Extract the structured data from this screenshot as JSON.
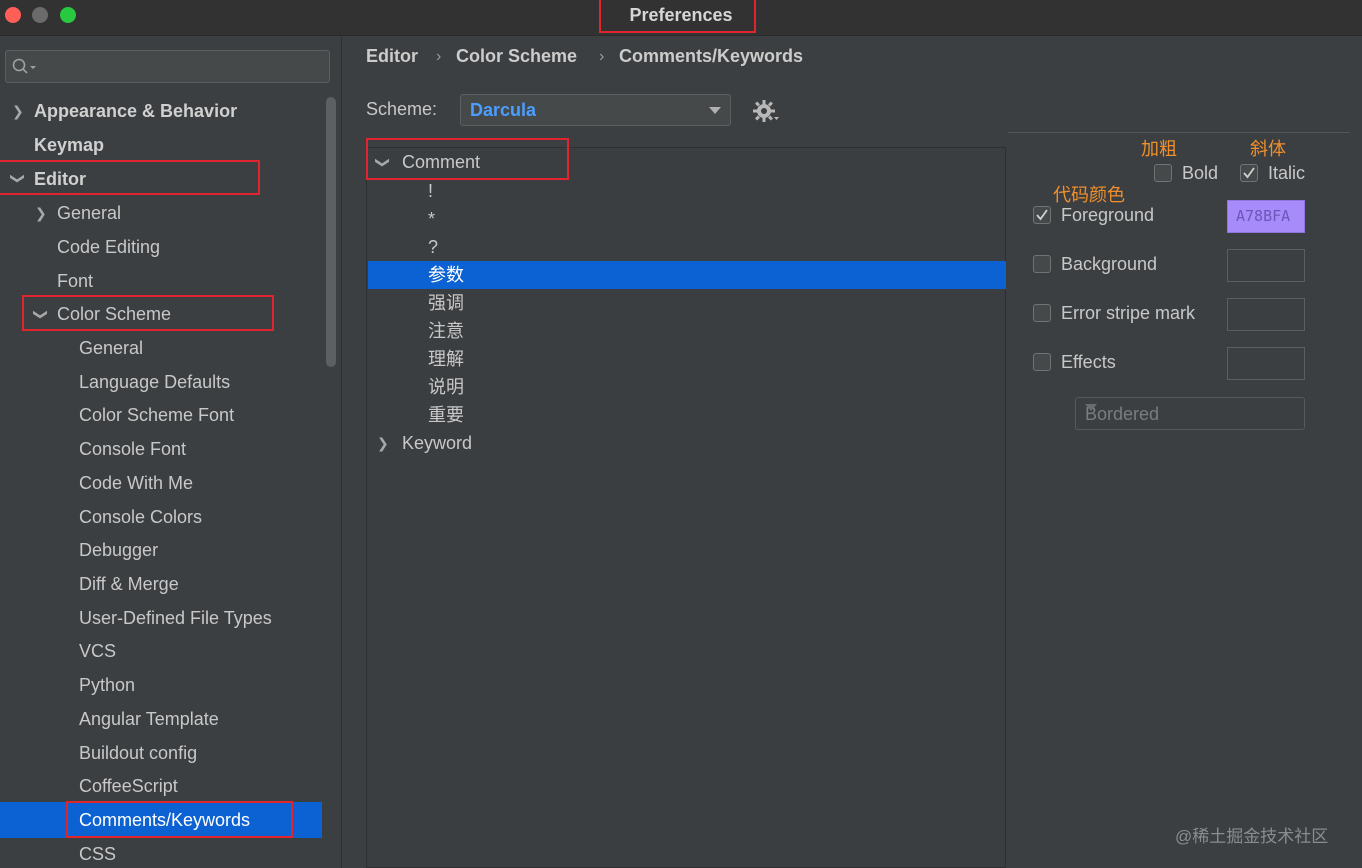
{
  "window": {
    "title": "Preferences"
  },
  "sidebar": {
    "search_placeholder": "",
    "items": [
      {
        "label": "Appearance & Behavior"
      },
      {
        "label": "Keymap"
      },
      {
        "label": "Editor"
      },
      {
        "label": "General"
      },
      {
        "label": "Code Editing"
      },
      {
        "label": "Font"
      },
      {
        "label": "Color Scheme"
      },
      {
        "label": "General"
      },
      {
        "label": "Language Defaults"
      },
      {
        "label": "Color Scheme Font"
      },
      {
        "label": "Console Font"
      },
      {
        "label": "Code With Me"
      },
      {
        "label": "Console Colors"
      },
      {
        "label": "Debugger"
      },
      {
        "label": "Diff & Merge"
      },
      {
        "label": "User-Defined File Types"
      },
      {
        "label": "VCS"
      },
      {
        "label": "Python"
      },
      {
        "label": "Angular Template"
      },
      {
        "label": "Buildout config"
      },
      {
        "label": "CoffeeScript"
      },
      {
        "label": "Comments/Keywords"
      },
      {
        "label": "CSS"
      }
    ]
  },
  "breadcrumb": [
    "Editor",
    "Color Scheme",
    "Comments/Keywords"
  ],
  "scheme": {
    "label": "Scheme:",
    "value": "Darcula"
  },
  "tree": {
    "comment_group": "Comment",
    "comment_children": [
      "!",
      "*",
      "?",
      "参数",
      "强调",
      "注意",
      "理解",
      "说明",
      "重要"
    ],
    "keyword_group": "Keyword"
  },
  "options": {
    "bold_label": "Bold",
    "italic_label": "Italic",
    "foreground_label": "Foreground",
    "foreground_value": "A78BFA",
    "background_label": "Background",
    "error_stripe_label": "Error stripe mark",
    "effects_label": "Effects",
    "effects_type": "Bordered"
  },
  "annotations": {
    "bold": "加粗",
    "italic": "斜体",
    "code_color": "代码颜色"
  },
  "watermark": "@稀土掘金技术社区",
  "colors": {
    "background": "#3c3f41",
    "selection": "#0d62d3",
    "accent": "#4a9eff",
    "highlight_box": "#e0252f",
    "annotation": "#f08f2b",
    "foreground_swatch": "#a78bfa"
  }
}
